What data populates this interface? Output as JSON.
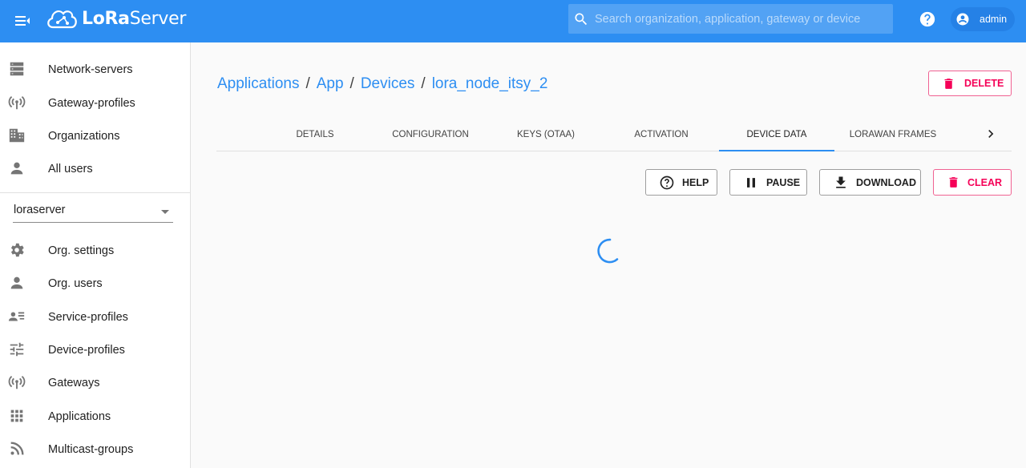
{
  "app": {
    "brand_prefix": "LoRa",
    "brand_suffix": "Server",
    "colors": {
      "primary": "#2d8ef2",
      "danger": "#f50057"
    }
  },
  "header": {
    "search_placeholder": "Search organization, application, gateway or device",
    "user_label": "admin"
  },
  "sidebar": {
    "admin_items": [
      {
        "label": "Network-servers",
        "icon": "server-icon"
      },
      {
        "label": "Gateway-profiles",
        "icon": "radio-tower-icon"
      },
      {
        "label": "Organizations",
        "icon": "domain-icon"
      },
      {
        "label": "All users",
        "icon": "account-icon"
      }
    ],
    "org_select_value": "loraserver",
    "org_items": [
      {
        "label": "Org. settings",
        "icon": "gear-icon"
      },
      {
        "label": "Org. users",
        "icon": "account-icon"
      },
      {
        "label": "Service-profiles",
        "icon": "account-details-icon"
      },
      {
        "label": "Device-profiles",
        "icon": "tune-icon"
      },
      {
        "label": "Gateways",
        "icon": "radio-tower-icon"
      },
      {
        "label": "Applications",
        "icon": "apps-grid-icon"
      },
      {
        "label": "Multicast-groups",
        "icon": "rss-icon"
      }
    ]
  },
  "breadcrumb": {
    "items": [
      "Applications",
      "App",
      "Devices",
      "lora_node_itsy_2"
    ],
    "separator": "/"
  },
  "delete_label": "DELETE",
  "tabs": [
    {
      "label": "DETAILS",
      "active": false
    },
    {
      "label": "CONFIGURATION",
      "active": false
    },
    {
      "label": "KEYS (OTAA)",
      "active": false
    },
    {
      "label": "ACTIVATION",
      "active": false
    },
    {
      "label": "DEVICE DATA",
      "active": true
    },
    {
      "label": "LORAWAN FRAMES",
      "active": false
    }
  ],
  "actions": {
    "help": "HELP",
    "pause": "PAUSE",
    "download": "DOWNLOAD",
    "clear": "CLEAR"
  }
}
